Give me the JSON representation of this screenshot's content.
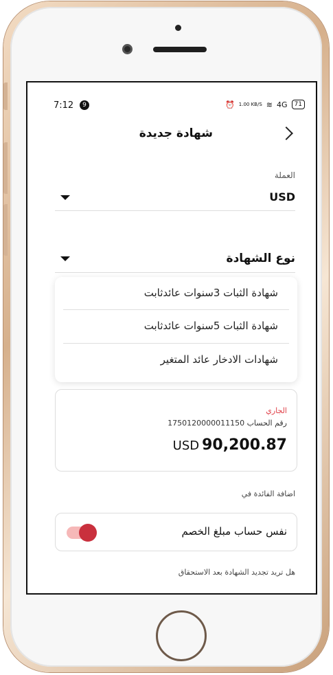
{
  "status_bar": {
    "time": "7:12",
    "notification_count": "9",
    "net_speed": "1.00 KB/S",
    "signal": "4G",
    "battery": "71"
  },
  "header": {
    "title": "شهادة جديدة"
  },
  "currency_field": {
    "label": "العملة",
    "value": "USD"
  },
  "certificate_type_field": {
    "label": "نوع الشهادة"
  },
  "certificate_options": [
    "شهادة الثبات 3سنوات عائدثابت",
    "شهادة الثبات 5سنوات عائدثابت",
    "شهادات الادخار  عائد المتغير"
  ],
  "account_card": {
    "type": "الجاري",
    "number": "رقم الحساب 1750120000011150",
    "currency": "USD",
    "balance": "90,200.87"
  },
  "interest": {
    "label": "اضافة الفائدة في",
    "option_text": "نفس حساب مبلغ الخصم",
    "toggle_on": true
  },
  "renew": {
    "label": "هل تريد تجديد الشهادة بعد الاستحقاق"
  },
  "colors": {
    "accent": "#c9303d",
    "accent_light": "#f6b8b8",
    "label_red": "#e0424a"
  }
}
